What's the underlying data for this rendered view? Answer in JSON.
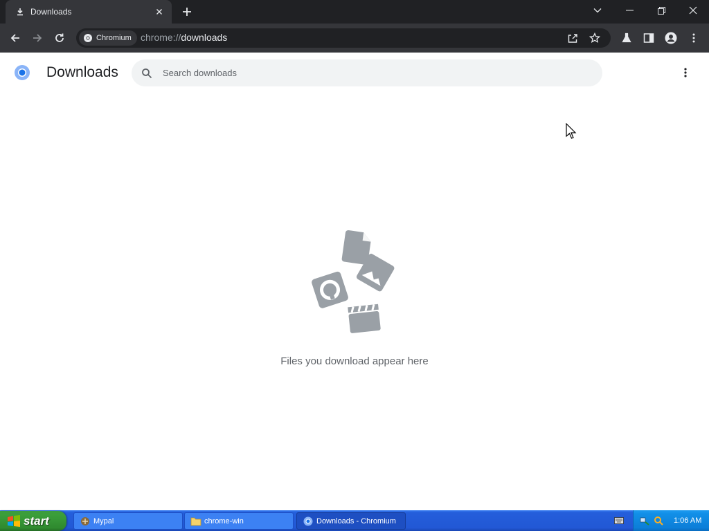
{
  "tab": {
    "title": "Downloads",
    "icon": "download-icon"
  },
  "window_controls": {
    "tab_search_icon": "chevron-down-icon",
    "minimize_icon": "minimize-icon",
    "restore_icon": "restore-icon",
    "close_icon": "close-icon"
  },
  "toolbar": {
    "site_chip": "Chromium",
    "url_scheme": "chrome://",
    "url_host": "downloads",
    "icons": [
      "back-arrow-icon",
      "forward-arrow-icon",
      "reload-icon",
      "share-icon",
      "bookmark-star-icon",
      "labs-flask-icon",
      "side-panel-icon",
      "profile-icon",
      "kebab-menu-icon"
    ]
  },
  "page": {
    "title": "Downloads",
    "search_placeholder": "Search downloads",
    "empty_message": "Files you download appear here"
  },
  "taskbar": {
    "start_label": "start",
    "tasks": [
      {
        "label": "Mypal",
        "icon": "mypal-icon",
        "active": false
      },
      {
        "label": "chrome-win",
        "icon": "folder-icon",
        "active": false
      },
      {
        "label": "Downloads - Chromium",
        "icon": "chromium-icon",
        "active": true
      }
    ],
    "clock": "1:06 AM"
  },
  "colors": {
    "tab_strip": "#202124",
    "toolbar": "#35363a",
    "accent_blue": "#1a73e8",
    "empty_art_gray": "#9aa0a6",
    "taskbar_blue": "#245edb",
    "start_green": "#3b9e3b"
  }
}
